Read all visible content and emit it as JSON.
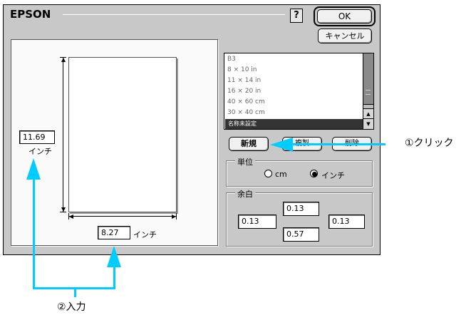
{
  "dialog": {
    "title": "EPSON",
    "help_label": "?",
    "ok_label": "OK",
    "cancel_label": "キャンセル"
  },
  "preview": {
    "height_value": "11.69",
    "height_unit": "インチ",
    "width_value": "8.27",
    "width_unit": "インチ"
  },
  "size_list": {
    "items": [
      "B3",
      "8 × 10 in",
      "11 × 14 in",
      "16 × 20 in",
      "40 × 60 cm",
      "30 × 40 cm"
    ],
    "selected": "名称未設定"
  },
  "buttons": {
    "new_label": "新規",
    "copy_label": "複製",
    "delete_label": "削除"
  },
  "unit_group": {
    "label": "単位",
    "cm_label": "cm",
    "inch_label": "インチ",
    "selected": "インチ"
  },
  "margin_group": {
    "label": "余白",
    "top": "0.13",
    "left": "0.13",
    "right": "0.13",
    "bottom": "0.57"
  },
  "annotations": {
    "click": "①クリック",
    "input": "②入力",
    "color": "#00ccff"
  }
}
